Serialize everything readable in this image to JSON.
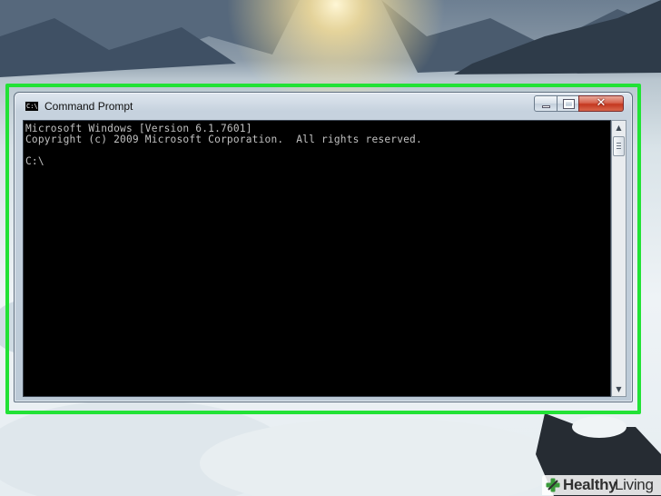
{
  "window": {
    "title": "Command Prompt",
    "icon": "cmd-icon",
    "icon_glyph": "C:\\",
    "close_glyph": "✕"
  },
  "console": {
    "lines": [
      "Microsoft Windows [Version 6.1.7601]",
      "Copyright (c) 2009 Microsoft Corporation.  All rights reserved.",
      "",
      "C:\\"
    ]
  },
  "scrollbar": {
    "up_arrow": "▲",
    "down_arrow": "▼"
  },
  "watermark": {
    "brand_part1": "Healthy",
    "brand_part2": "Living",
    "logo": "medical-cross-icon"
  },
  "colors": {
    "highlight_frame": "#22e236",
    "console_bg": "#000000",
    "console_text": "#c0c0c0"
  }
}
